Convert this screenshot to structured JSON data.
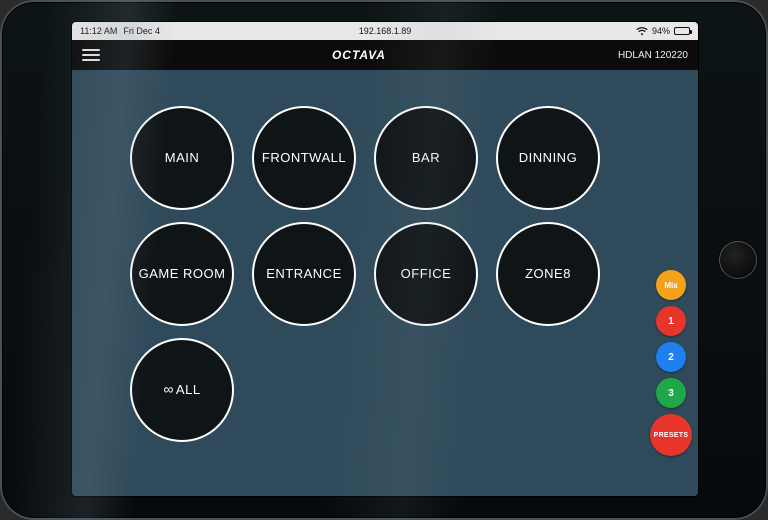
{
  "ios_status": {
    "time": "11:12 AM",
    "date": "Fri Dec 4",
    "url": "192.168.1.89",
    "battery_text": "94%",
    "battery_pct": 94
  },
  "header": {
    "brand": "OCTAVA",
    "device_label": "HDLAN 120220"
  },
  "zones": [
    {
      "label": "MAIN"
    },
    {
      "label": "FRONTWALL"
    },
    {
      "label": "BAR"
    },
    {
      "label": "DINNING"
    },
    {
      "label": "GAME ROOM"
    },
    {
      "label": "ENTRANCE"
    },
    {
      "label": "OFFICE"
    },
    {
      "label": "ZONE8"
    },
    {
      "label": "ALL",
      "all": true
    }
  ],
  "side_buttons": [
    {
      "label": "Mix",
      "color": "#f5a21b"
    },
    {
      "label": "1",
      "color": "#e7352c",
      "num": true
    },
    {
      "label": "2",
      "color": "#1d7ff0",
      "num": true
    },
    {
      "label": "3",
      "color": "#1fa84a",
      "num": true
    },
    {
      "label": "PRESETS",
      "color": "#e7352c",
      "big": true
    }
  ]
}
